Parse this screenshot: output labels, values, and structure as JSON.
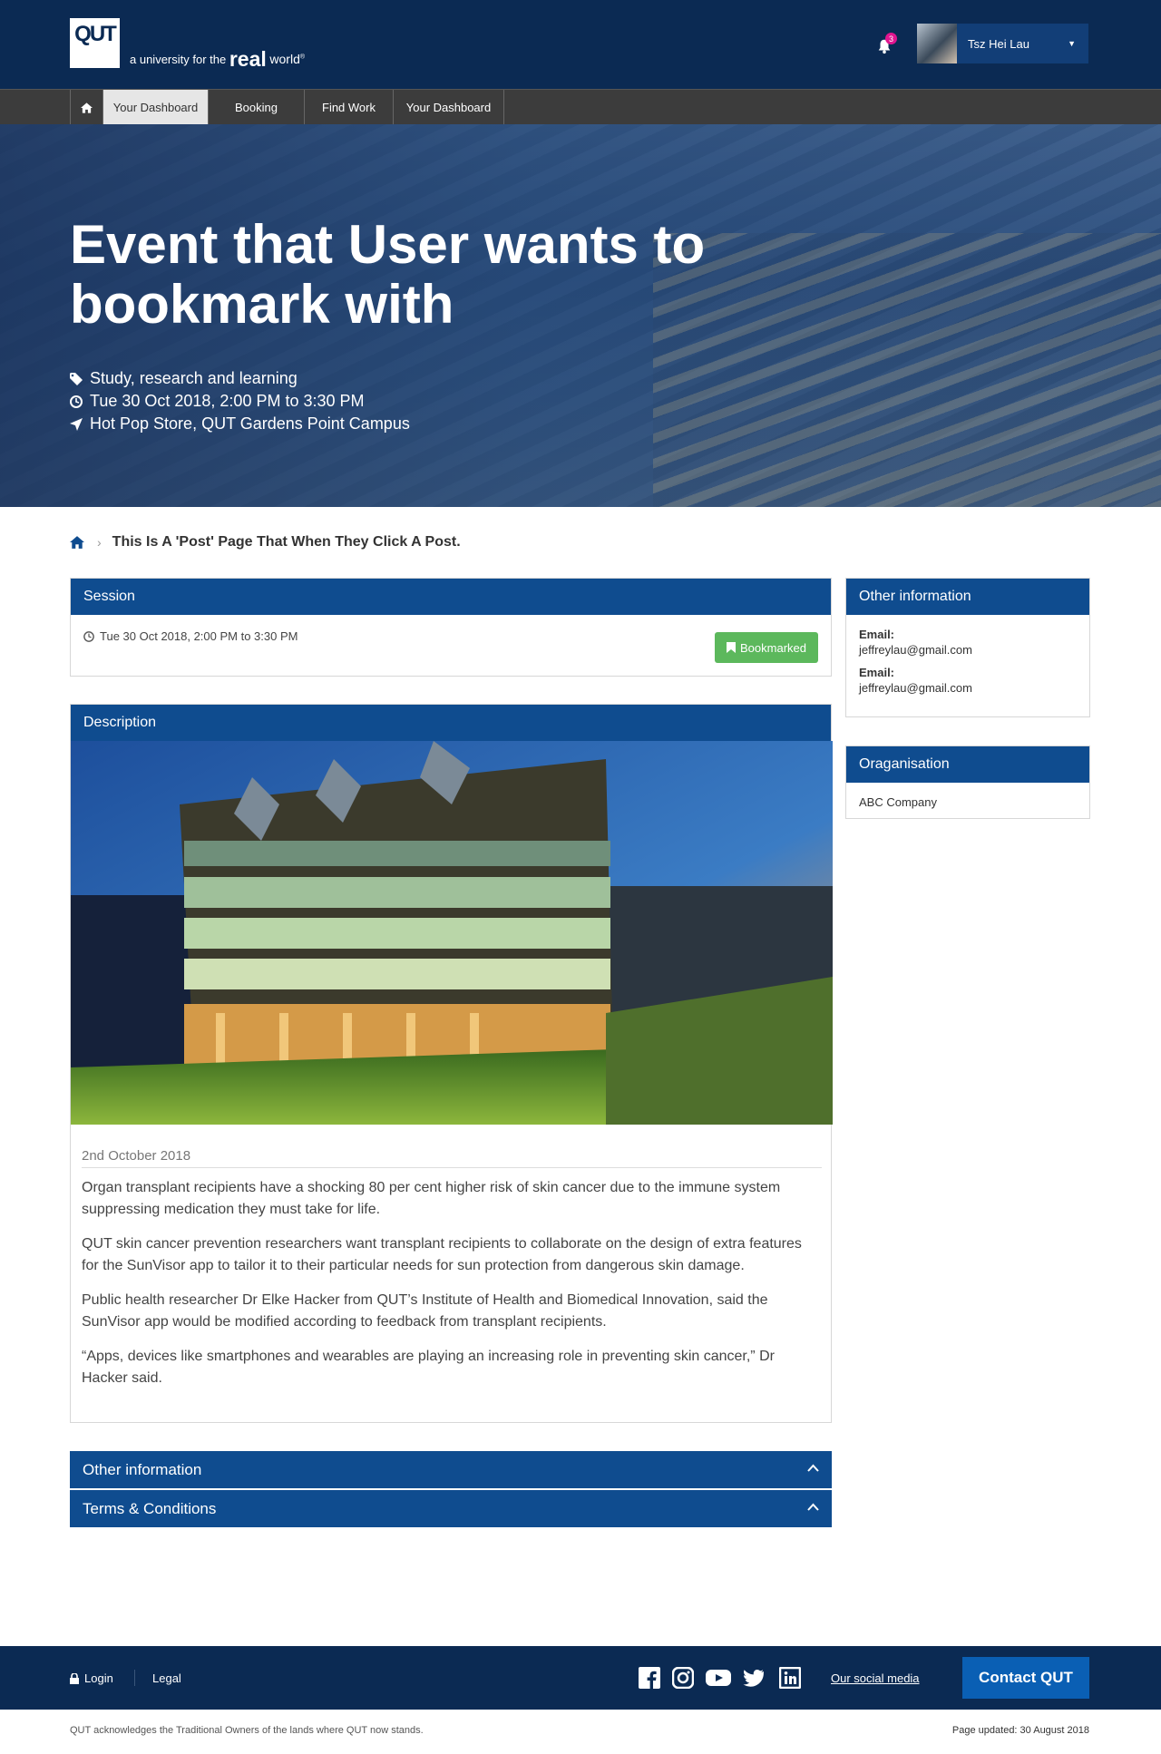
{
  "header": {
    "logo_text": "QUT",
    "tagline_prefix": "a university for the",
    "tagline_bold": "real",
    "tagline_suffix": "world",
    "notification_count": "3",
    "user_name": "Tsz Hei Lau",
    "colors": {
      "header_bg": "#0b2a53",
      "accent_blue": "#0f4c8f",
      "badge": "#e0158f",
      "success": "#5cb85c"
    }
  },
  "nav": {
    "home_icon": "home-icon",
    "items": [
      {
        "label": "Your Dashboard"
      },
      {
        "label": "Booking"
      },
      {
        "label": "Find Work"
      },
      {
        "label": "Your Dashboard"
      }
    ]
  },
  "hero": {
    "title": "Event that User wants to bookmark with",
    "category": "Study, research and learning",
    "datetime": "Tue 30 Oct 2018, 2:00 PM to 3:30 PM",
    "location": "Hot Pop Store, QUT Gardens Point Campus"
  },
  "breadcrumb": {
    "current": "This Is A 'Post' Page That When They Click A Post."
  },
  "session": {
    "heading": "Session",
    "datetime": "Tue 30 Oct 2018, 2:00 PM to 3:30 PM",
    "button_label": "Bookmarked"
  },
  "other_info": {
    "heading": "Other information",
    "fields": [
      {
        "label": "Email:",
        "value": "jeffreylau@gmail.com"
      },
      {
        "label": "Email:",
        "value": "jeffreylau@gmail.com"
      }
    ]
  },
  "organisation": {
    "heading": "Oraganisation",
    "value": "ABC Company"
  },
  "description": {
    "heading": "Description",
    "date": "2nd October 2018",
    "paragraphs": [
      "Organ transplant recipients have a shocking 80 per cent higher risk of skin cancer due to the immune system suppressing medication they must take for life.",
      "QUT skin cancer prevention researchers want transplant recipients to collaborate on the design of extra features for the SunVisor app to tailor it to their particular needs for sun protection from dangerous skin damage.",
      "Public health researcher Dr Elke Hacker from QUT’s Institute of Health and Biomedical Innovation, said the SunVisor app would be modified according to feedback from transplant recipients.",
      "“Apps, devices like smartphones and wearables are playing an increasing role in preventing skin cancer,” Dr Hacker said."
    ]
  },
  "accordions": [
    {
      "label": "Other information"
    },
    {
      "label": "Terms & Conditions"
    }
  ],
  "footer": {
    "login": "Login",
    "legal": "Legal",
    "social_icons": [
      "facebook-icon",
      "instagram-icon",
      "youtube-icon",
      "twitter-icon",
      "linkedin-icon"
    ],
    "social_link": "Our social media",
    "contact": "Contact QUT",
    "acknowledgement": "QUT acknowledges the Traditional Owners of the lands where QUT now stands.",
    "updated": "Page updated: 30 August 2018"
  }
}
